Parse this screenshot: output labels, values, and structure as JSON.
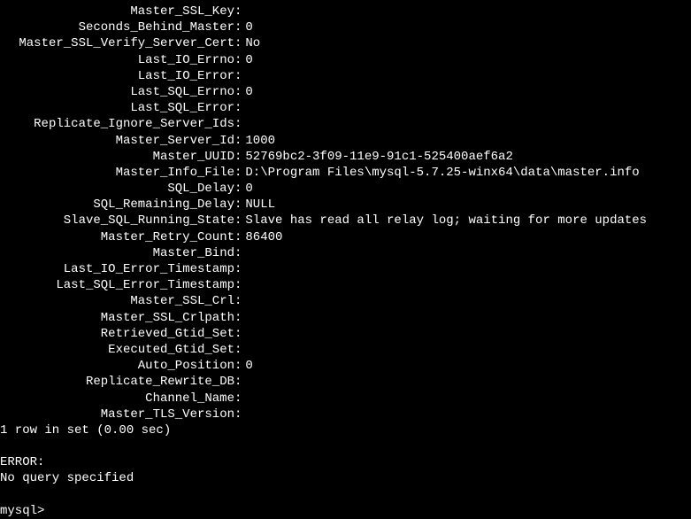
{
  "status": [
    {
      "label": "Master_SSL_Key",
      "value": ""
    },
    {
      "label": "Seconds_Behind_Master",
      "value": "0"
    },
    {
      "label": "Master_SSL_Verify_Server_Cert",
      "value": "No"
    },
    {
      "label": "Last_IO_Errno",
      "value": "0"
    },
    {
      "label": "Last_IO_Error",
      "value": ""
    },
    {
      "label": "Last_SQL_Errno",
      "value": "0"
    },
    {
      "label": "Last_SQL_Error",
      "value": ""
    },
    {
      "label": "Replicate_Ignore_Server_Ids",
      "value": ""
    },
    {
      "label": "Master_Server_Id",
      "value": "1000"
    },
    {
      "label": "Master_UUID",
      "value": "52769bc2-3f09-11e9-91c1-525400aef6a2"
    },
    {
      "label": "Master_Info_File",
      "value": "D:\\Program Files\\mysql-5.7.25-winx64\\data\\master.info"
    },
    {
      "label": "SQL_Delay",
      "value": "0"
    },
    {
      "label": "SQL_Remaining_Delay",
      "value": "NULL"
    },
    {
      "label": "Slave_SQL_Running_State",
      "value": "Slave has read all relay log; waiting for more updates"
    },
    {
      "label": "Master_Retry_Count",
      "value": "86400"
    },
    {
      "label": "Master_Bind",
      "value": ""
    },
    {
      "label": "Last_IO_Error_Timestamp",
      "value": ""
    },
    {
      "label": "Last_SQL_Error_Timestamp",
      "value": ""
    },
    {
      "label": "Master_SSL_Crl",
      "value": ""
    },
    {
      "label": "Master_SSL_Crlpath",
      "value": ""
    },
    {
      "label": "Retrieved_Gtid_Set",
      "value": ""
    },
    {
      "label": "Executed_Gtid_Set",
      "value": ""
    },
    {
      "label": "Auto_Position",
      "value": "0"
    },
    {
      "label": "Replicate_Rewrite_DB",
      "value": ""
    },
    {
      "label": "Channel_Name",
      "value": ""
    },
    {
      "label": "Master_TLS_Version",
      "value": ""
    }
  ],
  "footer": {
    "row_summary": "1 row in set (0.00 sec)",
    "error_label": "ERROR:",
    "error_message": "No query specified",
    "prompt": "mysql> "
  }
}
